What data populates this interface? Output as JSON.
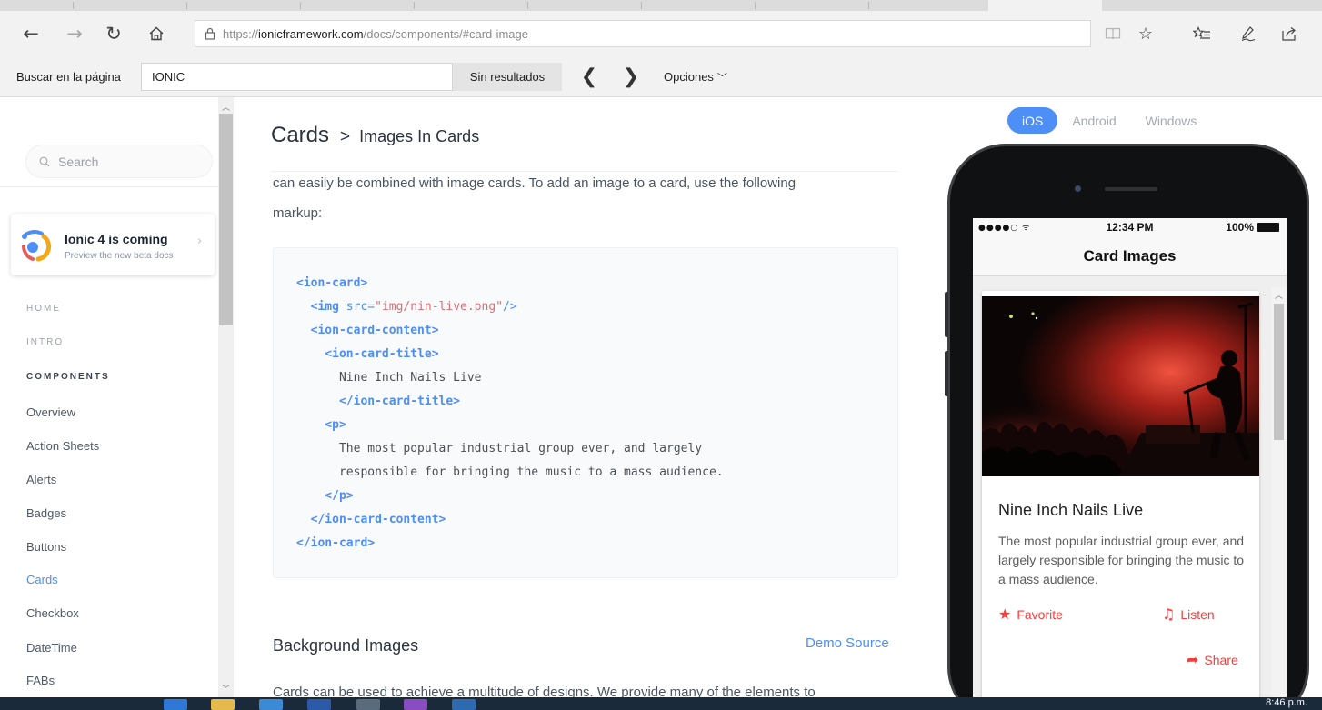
{
  "browser": {
    "url_prefix": "https://",
    "url_host": "ionicframework.com",
    "url_path": "/docs/components/#card-image",
    "icons": {
      "back": "arrow-left-icon",
      "forward": "arrow-right-icon",
      "refresh": "refresh-icon",
      "home": "home-icon",
      "lock": "lock-icon",
      "reading_view": "reading-view-icon",
      "favorite": "star-icon",
      "favorites_hub": "favorites-list-icon",
      "notes": "pen-icon",
      "share": "share-icon"
    }
  },
  "findbar": {
    "label": "Buscar en la página",
    "query": "IONIC",
    "status": "Sin resultados",
    "prev_glyph": "❮",
    "next_glyph": "❯",
    "options_label": "Opciones"
  },
  "sidebar": {
    "search_placeholder": "Search",
    "promo": {
      "title": "Ionic 4 is coming",
      "subtitle": "Preview the new beta docs"
    },
    "nav": [
      {
        "label": "HOME",
        "kind": "section"
      },
      {
        "label": "INTRO",
        "kind": "section"
      },
      {
        "label": "COMPONENTS",
        "kind": "section-strong"
      },
      {
        "label": "Overview",
        "kind": "item"
      },
      {
        "label": "Action Sheets",
        "kind": "item"
      },
      {
        "label": "Alerts",
        "kind": "item"
      },
      {
        "label": "Badges",
        "kind": "item"
      },
      {
        "label": "Buttons",
        "kind": "item"
      },
      {
        "label": "Cards",
        "kind": "active"
      },
      {
        "label": "Checkbox",
        "kind": "item"
      },
      {
        "label": "DateTime",
        "kind": "item"
      },
      {
        "label": "FABs",
        "kind": "item"
      }
    ]
  },
  "content": {
    "breadcrumb_main": "Cards",
    "breadcrumb_sep": ">",
    "breadcrumb_sub": "Images In Cards",
    "intro_line1": "can easily be combined with image cards. To add an image to a card, use the following",
    "intro_line2": "markup:",
    "section_title": "Background Images",
    "demo_link": "Demo Source",
    "cut_text": "Cards can be used to achieve a multitude of designs. We provide many of the elements to"
  },
  "code_lines": [
    [
      {
        "t": "<ion-card>",
        "c": "tag"
      }
    ],
    [
      {
        "t": "  <img ",
        "c": "tag"
      },
      {
        "t": "src=",
        "c": "attr"
      },
      {
        "t": "\"img/nin-live.png\"",
        "c": "str"
      },
      {
        "t": "/>",
        "c": "tag-n"
      }
    ],
    [
      {
        "t": "  <ion-card-content>",
        "c": "tag"
      }
    ],
    [
      {
        "t": "    <ion-card-title>",
        "c": "tag"
      }
    ],
    [
      {
        "t": "      Nine Inch Nails Live",
        "c": "txt"
      }
    ],
    [
      {
        "t": "      </ion-card-title>",
        "c": "tag"
      }
    ],
    [
      {
        "t": "    <p>",
        "c": "tag"
      }
    ],
    [
      {
        "t": "      The most popular industrial group ever, and largely",
        "c": "txt"
      }
    ],
    [
      {
        "t": "      responsible for bringing the music to a mass audience.",
        "c": "txt"
      }
    ],
    [
      {
        "t": "    </p>",
        "c": "tag"
      }
    ],
    [
      {
        "t": "  </ion-card-content>",
        "c": "tag"
      }
    ],
    [
      {
        "t": "</ion-card>",
        "c": "tag"
      }
    ]
  ],
  "preview": {
    "platforms": [
      {
        "label": "iOS",
        "active": true
      },
      {
        "label": "Android",
        "active": false
      },
      {
        "label": "Windows",
        "active": false
      }
    ],
    "status_signal": "●●●●○ ᯤ",
    "status_time": "12:34 PM",
    "status_battery": "100%",
    "nav_title": "Card Images",
    "card": {
      "title": "Nine Inch Nails Live",
      "text": "The most popular industrial group ever, and largely responsible for bringing the music to a mass audience.",
      "buttons": [
        {
          "label": "Favorite",
          "glyph": "★",
          "icon": "star-icon"
        },
        {
          "label": "Listen",
          "glyph": "♫",
          "icon": "music-note-icon"
        },
        {
          "label": "Share",
          "glyph": "➦",
          "icon": "share-arrow-icon"
        }
      ]
    }
  },
  "taskbar": {
    "clock": "8:46 p.m."
  },
  "colors": {
    "ionic_blue": "#4e8ef7",
    "ionic_red": "#f53d3d",
    "chrome_bg": "#f2f2f2"
  }
}
